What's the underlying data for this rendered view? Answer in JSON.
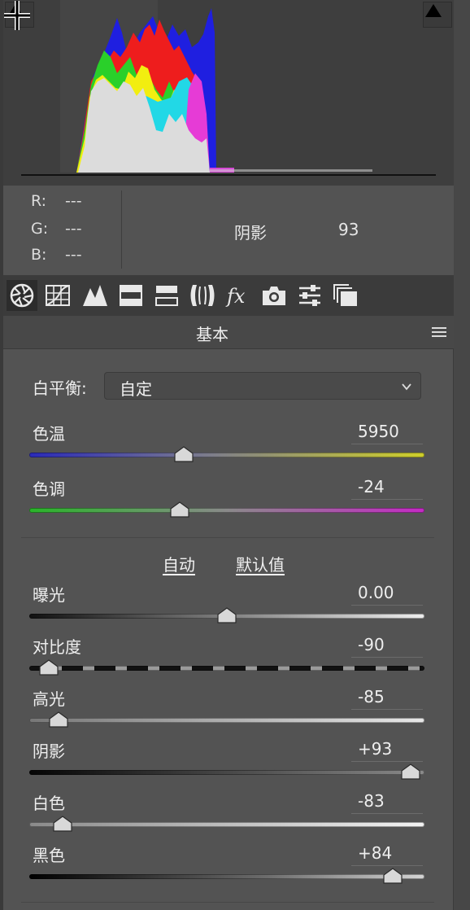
{
  "readout": {
    "r_label": "R:",
    "r_value": "---",
    "g_label": "G:",
    "g_value": "---",
    "b_label": "B:",
    "b_value": "---",
    "param_label": "阴影",
    "param_value": "93"
  },
  "toolbar": {
    "tools": [
      "basic-icon",
      "tone-curve-icon",
      "detail-icon",
      "hsl-icon",
      "split-toning-icon",
      "lens-corrections-icon",
      "effects-icon",
      "camera-calibration-icon",
      "presets-icon",
      "snapshots-icon"
    ],
    "active_index": 0
  },
  "section": {
    "title": "基本"
  },
  "white_balance": {
    "label": "白平衡:",
    "value": "自定"
  },
  "sliders": [
    {
      "label": "色温",
      "value": "5950",
      "position": 0.39
    },
    {
      "label": "色调",
      "value": "-24",
      "position": 0.38
    },
    {
      "label": "曝光",
      "value": "0.00",
      "position": 0.5
    },
    {
      "label": "对比度",
      "value": "-90",
      "position": 0.05
    },
    {
      "label": "高光",
      "value": "-85",
      "position": 0.075
    },
    {
      "label": "阴影",
      "value": "+93",
      "position": 0.965
    },
    {
      "label": "白色",
      "value": "-83",
      "position": 0.085
    },
    {
      "label": "黑色",
      "value": "+84",
      "position": 0.92
    }
  ],
  "actions": {
    "auto_label": "自动",
    "default_label": "默认值"
  },
  "colors": {
    "panel": "#535353",
    "histogram_bg": "#3e3e3e",
    "toolbar_bg": "#3b3b3b"
  }
}
